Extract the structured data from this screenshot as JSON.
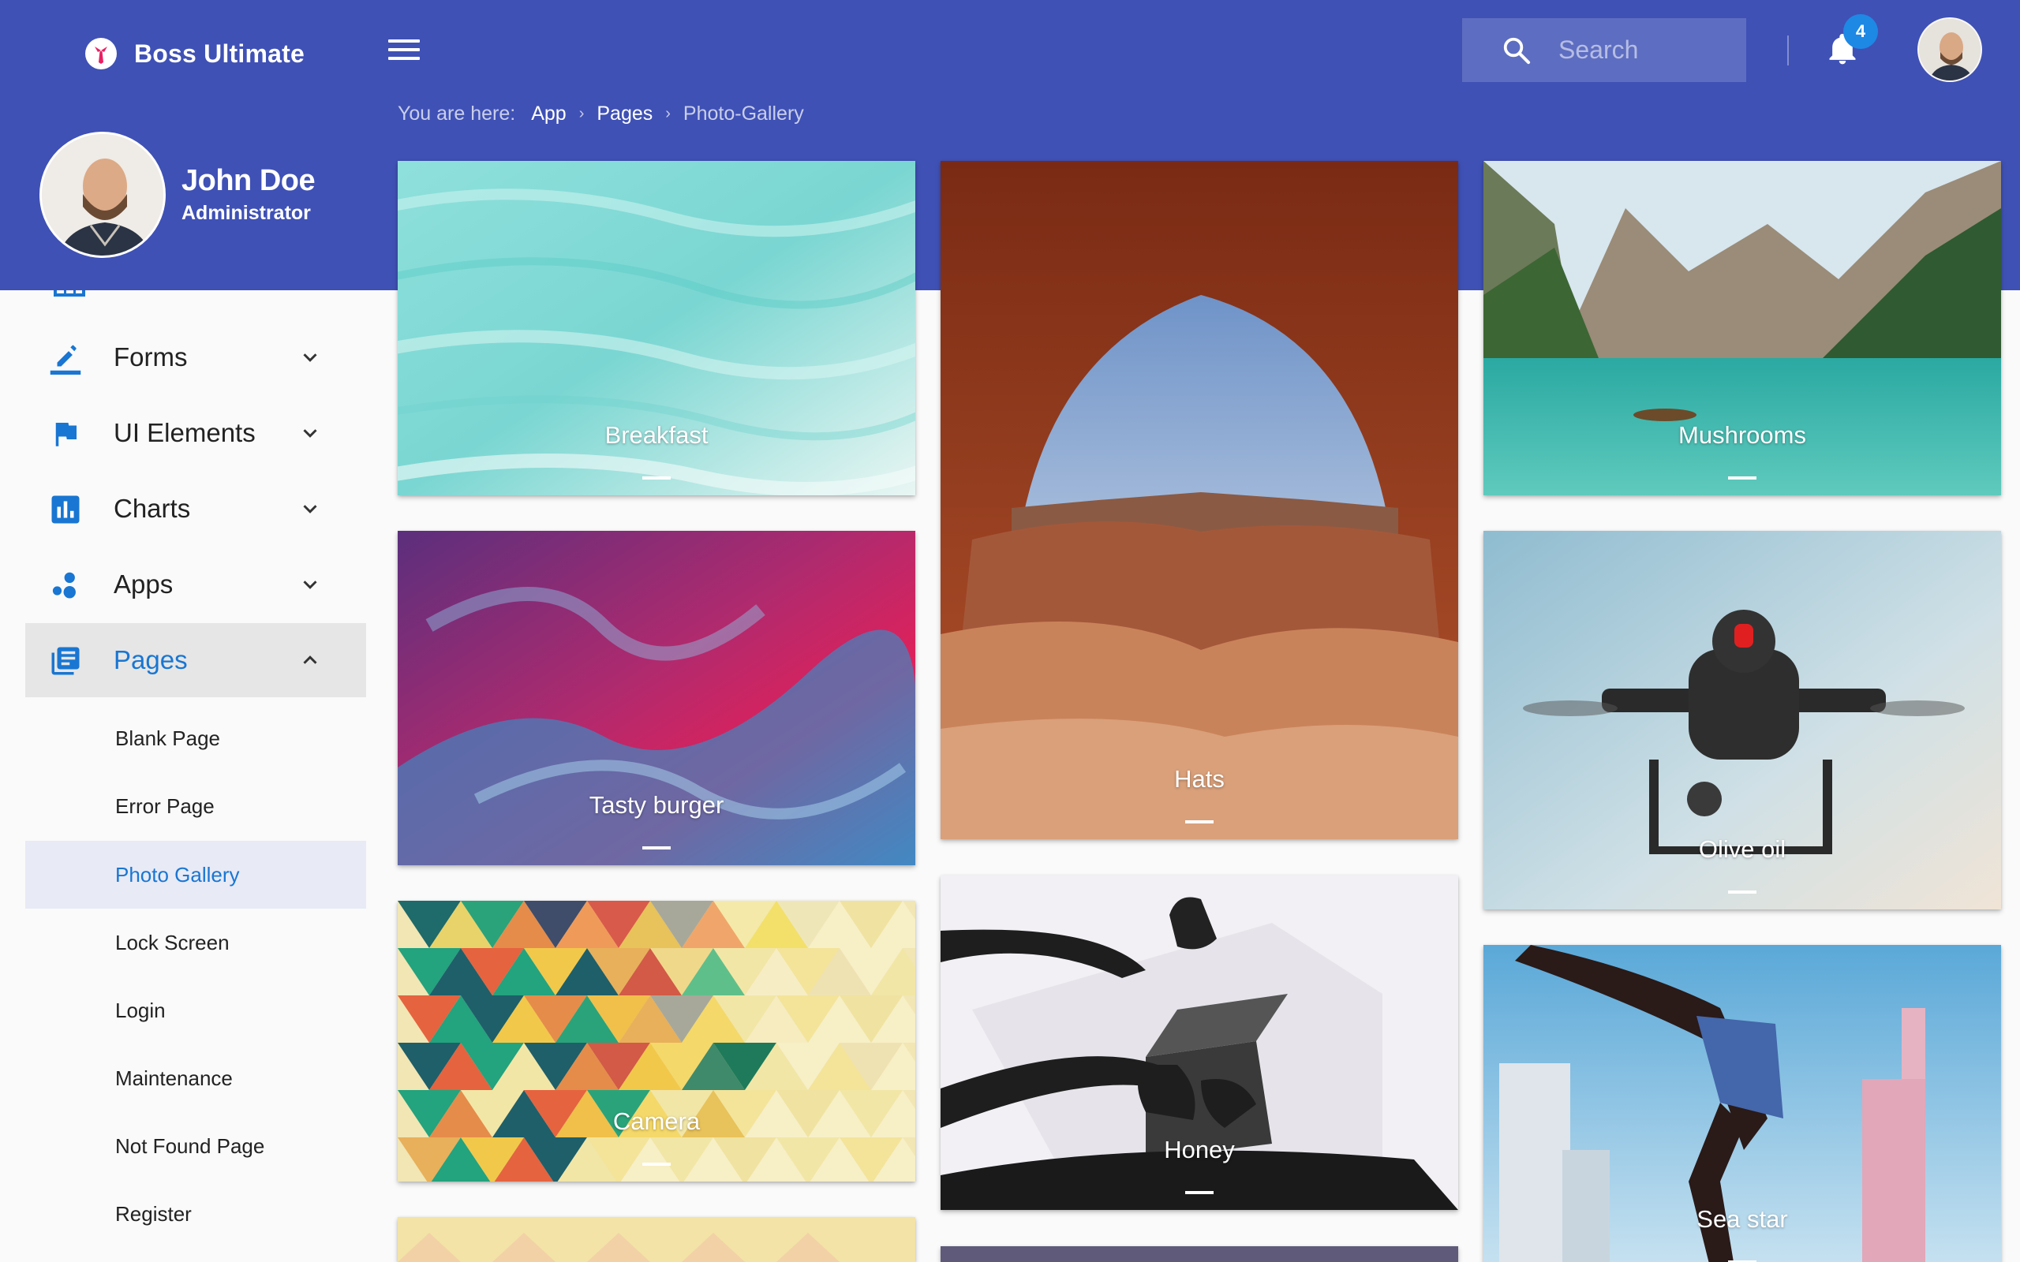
{
  "brand": {
    "name": "Boss Ultimate"
  },
  "search": {
    "placeholder": "Search"
  },
  "notifications": {
    "count": "4"
  },
  "breadcrumb": {
    "prefix": "You are here:",
    "items": [
      "App",
      "Pages"
    ],
    "current": "Photo-Gallery"
  },
  "profile": {
    "name": "John Doe",
    "role": "Administrator"
  },
  "sidebar": {
    "items": [
      {
        "label": "Forms",
        "icon": "pencil-icon"
      },
      {
        "label": "UI Elements",
        "icon": "flag-icon"
      },
      {
        "label": "Charts",
        "icon": "bar-chart-icon"
      },
      {
        "label": "Apps",
        "icon": "bubbles-icon"
      },
      {
        "label": "Pages",
        "icon": "library-books-icon",
        "expanded": true
      }
    ],
    "subitems": [
      "Blank Page",
      "Error Page",
      "Photo Gallery",
      "Lock Screen",
      "Login",
      "Maintenance",
      "Not Found Page",
      "Register"
    ],
    "active_subitem": "Photo Gallery"
  },
  "gallery": {
    "cards": [
      "Breakfast",
      "Hats",
      "Mushrooms",
      "Tasty burger",
      "Olive oil",
      "Camera",
      "Honey",
      "Sea star"
    ]
  },
  "colors": {
    "primary": "#3f51b5",
    "accent": "#1976d2",
    "badge": "#1e88e5"
  }
}
